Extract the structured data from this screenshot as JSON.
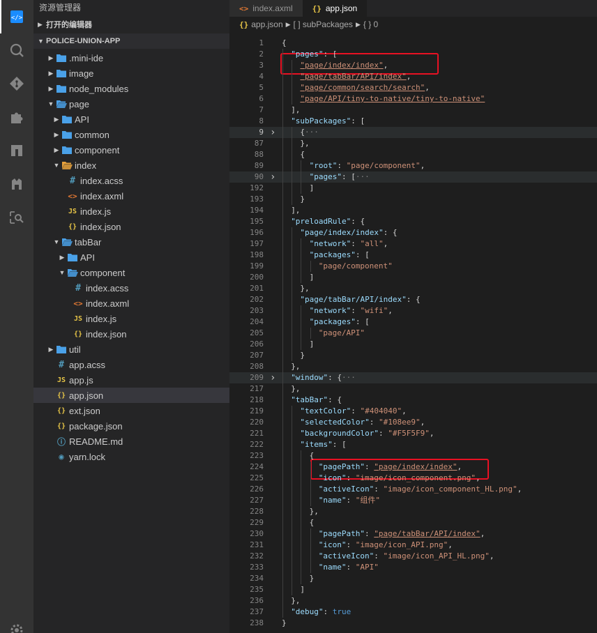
{
  "sidebar": {
    "title": "资源管理器",
    "open_editors": "打开的编辑器",
    "project": "POLICE-UNION-APP",
    "tree": [
      {
        "label": ".mini-ide",
        "depth": 0,
        "kind": "folder",
        "state": "closed"
      },
      {
        "label": "image",
        "depth": 0,
        "kind": "folder",
        "state": "closed"
      },
      {
        "label": "node_modules",
        "depth": 0,
        "kind": "folder",
        "state": "closed"
      },
      {
        "label": "page",
        "depth": 0,
        "kind": "folder",
        "state": "open"
      },
      {
        "label": "API",
        "depth": 1,
        "kind": "folder",
        "state": "closed"
      },
      {
        "label": "common",
        "depth": 1,
        "kind": "folder",
        "state": "closed"
      },
      {
        "label": "component",
        "depth": 1,
        "kind": "folder",
        "state": "closed"
      },
      {
        "label": "index",
        "depth": 1,
        "kind": "folder-special",
        "state": "open"
      },
      {
        "label": "index.acss",
        "depth": 2,
        "kind": "acss"
      },
      {
        "label": "index.axml",
        "depth": 2,
        "kind": "axml"
      },
      {
        "label": "index.js",
        "depth": 2,
        "kind": "js"
      },
      {
        "label": "index.json",
        "depth": 2,
        "kind": "json"
      },
      {
        "label": "tabBar",
        "depth": 1,
        "kind": "folder",
        "state": "open"
      },
      {
        "label": "API",
        "depth": 2,
        "kind": "folder",
        "state": "closed"
      },
      {
        "label": "component",
        "depth": 2,
        "kind": "folder",
        "state": "open"
      },
      {
        "label": "index.acss",
        "depth": 3,
        "kind": "acss"
      },
      {
        "label": "index.axml",
        "depth": 3,
        "kind": "axml"
      },
      {
        "label": "index.js",
        "depth": 3,
        "kind": "js"
      },
      {
        "label": "index.json",
        "depth": 3,
        "kind": "json"
      },
      {
        "label": "util",
        "depth": 0,
        "kind": "folder",
        "state": "closed"
      },
      {
        "label": "app.acss",
        "depth": 0,
        "kind": "acss"
      },
      {
        "label": "app.js",
        "depth": 0,
        "kind": "js"
      },
      {
        "label": "app.json",
        "depth": 0,
        "kind": "json",
        "selected": true
      },
      {
        "label": "ext.json",
        "depth": 0,
        "kind": "json"
      },
      {
        "label": "package.json",
        "depth": 0,
        "kind": "json"
      },
      {
        "label": "README.md",
        "depth": 0,
        "kind": "info"
      },
      {
        "label": "yarn.lock",
        "depth": 0,
        "kind": "yarn"
      }
    ]
  },
  "tabs": [
    {
      "label": "index.axml",
      "icon": "axml",
      "active": false
    },
    {
      "label": "app.json",
      "icon": "json",
      "active": true
    }
  ],
  "breadcrumb": {
    "file": "app.json",
    "items": [
      "[ ] subPackages",
      "{ } 0"
    ]
  },
  "icon_glyphs": {
    "js": "JS",
    "json": "{}",
    "acss": "#",
    "axml": "<>",
    "info": "ⓘ",
    "yarn": "◉"
  },
  "colors": {
    "folder": "#4aa1e8",
    "folder_special": "#e8a23c",
    "highlight_box": "#e81123"
  },
  "editor": {
    "lines": [
      {
        "n": "1",
        "indent": 0,
        "parts": [
          [
            "p",
            "{"
          ]
        ]
      },
      {
        "n": "2",
        "indent": 1,
        "parts": [
          [
            "k",
            "\"pages\""
          ],
          [
            "p",
            ": ["
          ]
        ]
      },
      {
        "n": "3",
        "indent": 2,
        "parts": [
          [
            "su",
            "\"page/index/index\""
          ],
          [
            "p",
            ","
          ]
        ]
      },
      {
        "n": "4",
        "indent": 2,
        "parts": [
          [
            "su",
            "\"page/tabBar/API/index\""
          ],
          [
            "p",
            ","
          ]
        ]
      },
      {
        "n": "5",
        "indent": 2,
        "parts": [
          [
            "su",
            "\"page/common/search/search\""
          ],
          [
            "p",
            ","
          ]
        ]
      },
      {
        "n": "6",
        "indent": 2,
        "parts": [
          [
            "su",
            "\"page/API/tiny-to-native/tiny-to-native\""
          ]
        ]
      },
      {
        "n": "7",
        "indent": 1,
        "parts": [
          [
            "p",
            "],"
          ]
        ]
      },
      {
        "n": "8",
        "indent": 1,
        "parts": [
          [
            "k",
            "\"subPackages\""
          ],
          [
            "p",
            ": ["
          ]
        ]
      },
      {
        "n": "9",
        "indent": 2,
        "fold": true,
        "hl": true,
        "cur": true,
        "parts": [
          [
            "p",
            "{"
          ],
          [
            "e",
            "···"
          ]
        ]
      },
      {
        "n": "87",
        "indent": 2,
        "parts": [
          [
            "p",
            "},"
          ]
        ]
      },
      {
        "n": "88",
        "indent": 2,
        "parts": [
          [
            "p",
            "{"
          ]
        ]
      },
      {
        "n": "89",
        "indent": 3,
        "parts": [
          [
            "k",
            "\"root\""
          ],
          [
            "p",
            ": "
          ],
          [
            "s",
            "\"page/component\""
          ],
          [
            "p",
            ","
          ]
        ]
      },
      {
        "n": "90",
        "indent": 3,
        "fold": true,
        "hl": true,
        "parts": [
          [
            "k",
            "\"pages\""
          ],
          [
            "p",
            ": ["
          ],
          [
            "e",
            "···"
          ]
        ]
      },
      {
        "n": "192",
        "indent": 3,
        "parts": [
          [
            "p",
            "]"
          ]
        ]
      },
      {
        "n": "193",
        "indent": 2,
        "parts": [
          [
            "p",
            "}"
          ]
        ]
      },
      {
        "n": "194",
        "indent": 1,
        "parts": [
          [
            "p",
            "],"
          ]
        ]
      },
      {
        "n": "195",
        "indent": 1,
        "parts": [
          [
            "k",
            "\"preloadRule\""
          ],
          [
            "p",
            ": {"
          ]
        ]
      },
      {
        "n": "196",
        "indent": 2,
        "parts": [
          [
            "k",
            "\"page/index/index\""
          ],
          [
            "p",
            ": {"
          ]
        ]
      },
      {
        "n": "197",
        "indent": 3,
        "parts": [
          [
            "k",
            "\"network\""
          ],
          [
            "p",
            ": "
          ],
          [
            "s",
            "\"all\""
          ],
          [
            "p",
            ","
          ]
        ]
      },
      {
        "n": "198",
        "indent": 3,
        "parts": [
          [
            "k",
            "\"packages\""
          ],
          [
            "p",
            ": ["
          ]
        ]
      },
      {
        "n": "199",
        "indent": 4,
        "parts": [
          [
            "s",
            "\"page/component\""
          ]
        ]
      },
      {
        "n": "200",
        "indent": 3,
        "parts": [
          [
            "p",
            "]"
          ]
        ]
      },
      {
        "n": "201",
        "indent": 2,
        "parts": [
          [
            "p",
            "},"
          ]
        ]
      },
      {
        "n": "202",
        "indent": 2,
        "parts": [
          [
            "k",
            "\"page/tabBar/API/index\""
          ],
          [
            "p",
            ": {"
          ]
        ]
      },
      {
        "n": "203",
        "indent": 3,
        "parts": [
          [
            "k",
            "\"network\""
          ],
          [
            "p",
            ": "
          ],
          [
            "s",
            "\"wifi\""
          ],
          [
            "p",
            ","
          ]
        ]
      },
      {
        "n": "204",
        "indent": 3,
        "parts": [
          [
            "k",
            "\"packages\""
          ],
          [
            "p",
            ": ["
          ]
        ]
      },
      {
        "n": "205",
        "indent": 4,
        "parts": [
          [
            "s",
            "\"page/API\""
          ]
        ]
      },
      {
        "n": "206",
        "indent": 3,
        "parts": [
          [
            "p",
            "]"
          ]
        ]
      },
      {
        "n": "207",
        "indent": 2,
        "parts": [
          [
            "p",
            "}"
          ]
        ]
      },
      {
        "n": "208",
        "indent": 1,
        "parts": [
          [
            "p",
            "},"
          ]
        ]
      },
      {
        "n": "209",
        "indent": 1,
        "fold": true,
        "hl": true,
        "parts": [
          [
            "k",
            "\"window\""
          ],
          [
            "p",
            ": {"
          ],
          [
            "e",
            "···"
          ]
        ]
      },
      {
        "n": "217",
        "indent": 1,
        "parts": [
          [
            "p",
            "},"
          ]
        ]
      },
      {
        "n": "218",
        "indent": 1,
        "parts": [
          [
            "k",
            "\"tabBar\""
          ],
          [
            "p",
            ": {"
          ]
        ]
      },
      {
        "n": "219",
        "indent": 2,
        "parts": [
          [
            "k",
            "\"textColor\""
          ],
          [
            "p",
            ": "
          ],
          [
            "s",
            "\"#404040\""
          ],
          [
            "p",
            ","
          ]
        ]
      },
      {
        "n": "220",
        "indent": 2,
        "parts": [
          [
            "k",
            "\"selectedColor\""
          ],
          [
            "p",
            ": "
          ],
          [
            "s",
            "\"#108ee9\""
          ],
          [
            "p",
            ","
          ]
        ]
      },
      {
        "n": "221",
        "indent": 2,
        "parts": [
          [
            "k",
            "\"backgroundColor\""
          ],
          [
            "p",
            ": "
          ],
          [
            "s",
            "\"#F5F5F9\""
          ],
          [
            "p",
            ","
          ]
        ]
      },
      {
        "n": "222",
        "indent": 2,
        "parts": [
          [
            "k",
            "\"items\""
          ],
          [
            "p",
            ": ["
          ]
        ]
      },
      {
        "n": "223",
        "indent": 3,
        "parts": [
          [
            "p",
            "{"
          ]
        ]
      },
      {
        "n": "224",
        "indent": 4,
        "parts": [
          [
            "k",
            "\"pagePath\""
          ],
          [
            "p",
            ": "
          ],
          [
            "su",
            "\"page/index/index\""
          ],
          [
            "p",
            ","
          ]
        ]
      },
      {
        "n": "225",
        "indent": 4,
        "parts": [
          [
            "k",
            "\"icon\""
          ],
          [
            "p",
            ": "
          ],
          [
            "s",
            "\"image/icon_component.png\""
          ],
          [
            "p",
            ","
          ]
        ]
      },
      {
        "n": "226",
        "indent": 4,
        "parts": [
          [
            "k",
            "\"activeIcon\""
          ],
          [
            "p",
            ": "
          ],
          [
            "s",
            "\"image/icon_component_HL.png\""
          ],
          [
            "p",
            ","
          ]
        ]
      },
      {
        "n": "227",
        "indent": 4,
        "parts": [
          [
            "k",
            "\"name\""
          ],
          [
            "p",
            ": "
          ],
          [
            "s",
            "\"组件\""
          ]
        ]
      },
      {
        "n": "228",
        "indent": 3,
        "parts": [
          [
            "p",
            "},"
          ]
        ]
      },
      {
        "n": "229",
        "indent": 3,
        "parts": [
          [
            "p",
            "{"
          ]
        ]
      },
      {
        "n": "230",
        "indent": 4,
        "parts": [
          [
            "k",
            "\"pagePath\""
          ],
          [
            "p",
            ": "
          ],
          [
            "su",
            "\"page/tabBar/API/index\""
          ],
          [
            "p",
            ","
          ]
        ]
      },
      {
        "n": "231",
        "indent": 4,
        "parts": [
          [
            "k",
            "\"icon\""
          ],
          [
            "p",
            ": "
          ],
          [
            "s",
            "\"image/icon_API.png\""
          ],
          [
            "p",
            ","
          ]
        ]
      },
      {
        "n": "232",
        "indent": 4,
        "parts": [
          [
            "k",
            "\"activeIcon\""
          ],
          [
            "p",
            ": "
          ],
          [
            "s",
            "\"image/icon_API_HL.png\""
          ],
          [
            "p",
            ","
          ]
        ]
      },
      {
        "n": "233",
        "indent": 4,
        "parts": [
          [
            "k",
            "\"name\""
          ],
          [
            "p",
            ": "
          ],
          [
            "s",
            "\"API\""
          ]
        ]
      },
      {
        "n": "234",
        "indent": 3,
        "parts": [
          [
            "p",
            "}"
          ]
        ]
      },
      {
        "n": "235",
        "indent": 2,
        "parts": [
          [
            "p",
            "]"
          ]
        ]
      },
      {
        "n": "236",
        "indent": 1,
        "parts": [
          [
            "p",
            "},"
          ]
        ]
      },
      {
        "n": "237",
        "indent": 1,
        "parts": [
          [
            "k",
            "\"debug\""
          ],
          [
            "p",
            ": "
          ],
          [
            "b",
            "true"
          ]
        ]
      },
      {
        "n": "238",
        "indent": 0,
        "parts": [
          [
            "p",
            "}"
          ]
        ]
      }
    ]
  }
}
